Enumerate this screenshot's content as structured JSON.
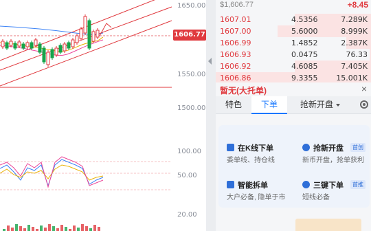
{
  "chart": {
    "y_axis_main": [
      "1650.00",
      "1550.00",
      "1500.00"
    ],
    "y_axis_osc": [
      "100.00",
      "50.00",
      "20.00"
    ],
    "current_price_tag": "1606.77",
    "colors": {
      "up": "#e0393e",
      "down": "#16a34a",
      "channel": "#e0393e",
      "ma1": "#3b82f6",
      "ma2": "#eab308",
      "ma3": "#ec4899"
    }
  },
  "orderbook": {
    "last_price": "$1,606.77",
    "change": "+8.45",
    "rows": [
      {
        "price": "1607.01",
        "volume": "4.5356",
        "total": "7.289K",
        "bar_ratio": 0.49
      },
      {
        "price": "1607.00",
        "volume": "5.6000",
        "total": "8.999K",
        "bar_ratio": 0.6
      },
      {
        "price": "1606.99",
        "volume": "1.4852",
        "total": "2.387K",
        "bar_ratio": 0.16
      },
      {
        "price": "1606.93",
        "volume": "0.0475",
        "total": "76.33",
        "bar_ratio": 0.01
      },
      {
        "price": "1606.92",
        "volume": "4.6085",
        "total": "7.405K",
        "bar_ratio": 0.49
      },
      {
        "price": "1606.86",
        "volume": "9.3355",
        "total": "15.001K",
        "bar_ratio": 1.0
      }
    ]
  },
  "orders_panel": {
    "title": "暂无(大托单)",
    "close_icon": "×",
    "tabs": [
      {
        "label": "特色"
      },
      {
        "label": "下单"
      },
      {
        "label": "抢新开盘"
      }
    ],
    "active_tab": "下单"
  },
  "features": [
    {
      "title": "在K线下单",
      "subtitle": "委单线、持仓线",
      "badge": "",
      "icon": "chart-order-icon"
    },
    {
      "title": "抢新开盘",
      "subtitle": "新币开盘，抢单获利",
      "badge": "首创",
      "icon": "clock-icon"
    },
    {
      "title": "智能拆单",
      "subtitle": "大户必备, 隐单于市",
      "badge": "",
      "icon": "split-icon"
    },
    {
      "title": "三键下单",
      "subtitle": "短线必备",
      "badge": "首推",
      "icon": "rocket-icon"
    }
  ]
}
